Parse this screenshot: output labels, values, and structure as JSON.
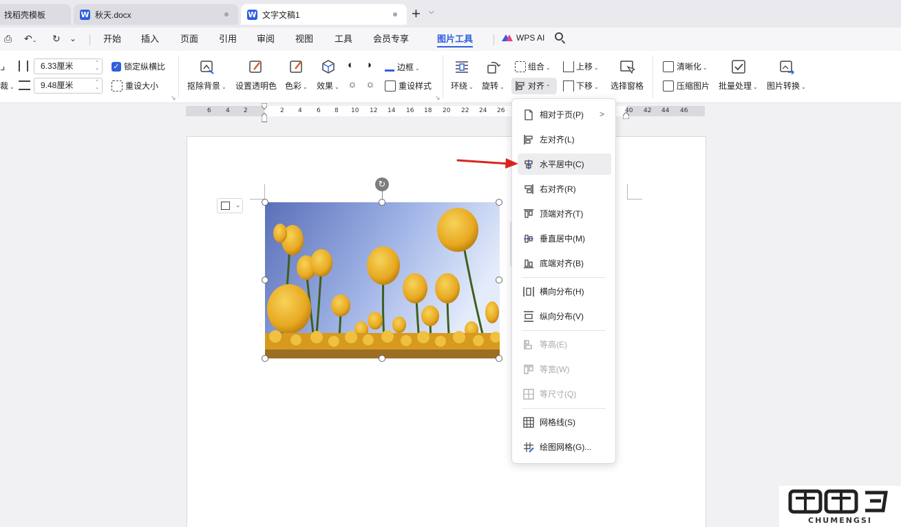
{
  "tabs": [
    {
      "label": "找稻壳模板",
      "active": false
    },
    {
      "label": "秋天.docx",
      "active": false,
      "icon": "word-icon"
    },
    {
      "label": "文字文稿1",
      "active": true,
      "icon": "word-icon"
    }
  ],
  "menu": {
    "items": [
      "开始",
      "插入",
      "页面",
      "引用",
      "审阅",
      "视图",
      "工具",
      "会员专享",
      "图片工具"
    ],
    "active": "图片工具",
    "ai_label": "WPS AI"
  },
  "ribbon": {
    "height_value": "6.33厘米",
    "width_value": "9.48厘米",
    "lock_ratio": "锁定纵横比",
    "reset_size": "重设大小",
    "remove_bg": "抠除背景",
    "set_transparent": "设置透明色",
    "color": "色彩",
    "effects": "效果",
    "border": "边框",
    "reset_style": "重设样式",
    "wrap": "环绕",
    "rotate": "旋转",
    "group": "组合",
    "align": "对齐",
    "bring_forward": "上移",
    "send_backward": "下移",
    "selection_pane": "选择窗格",
    "sharpen": "清晰化",
    "compress": "压缩图片",
    "batch": "批量处理",
    "convert": "图片转换"
  },
  "ruler": {
    "left_ticks": [
      "6",
      "4",
      "2"
    ],
    "right_ticks": [
      "2",
      "4",
      "6",
      "8",
      "10",
      "12",
      "14",
      "16",
      "18",
      "20",
      "22",
      "24",
      "26"
    ],
    "far_ticks": [
      "40",
      "42",
      "44",
      "46"
    ]
  },
  "align_menu": {
    "items": [
      {
        "label": "相对于页(P)",
        "icon": "relative-page-icon",
        "submenu": true
      },
      {
        "label": "左对齐(L)",
        "icon": "align-left-icon"
      },
      {
        "label": "水平居中(C)",
        "icon": "align-center-icon",
        "hover": true
      },
      {
        "label": "右对齐(R)",
        "icon": "align-right-icon"
      },
      {
        "label": "顶端对齐(T)",
        "icon": "align-top-icon"
      },
      {
        "label": "垂直居中(M)",
        "icon": "align-middle-icon"
      },
      {
        "label": "底端对齐(B)",
        "icon": "align-bottom-icon"
      },
      {
        "label": "横向分布(H)",
        "icon": "distribute-horizontal-icon"
      },
      {
        "label": "纵向分布(V)",
        "icon": "distribute-vertical-icon"
      },
      {
        "label": "等高(E)",
        "icon": "equal-height-icon",
        "disabled": true
      },
      {
        "label": "等宽(W)",
        "icon": "equal-width-icon",
        "disabled": true
      },
      {
        "label": "等尺寸(Q)",
        "icon": "equal-size-icon",
        "disabled": true
      },
      {
        "label": "网格线(S)",
        "icon": "gridlines-icon"
      },
      {
        "label": "绘图网格(G)...",
        "icon": "drawing-grid-icon"
      }
    ]
  },
  "watermark": {
    "text": "CHUMENGSI"
  },
  "colors": {
    "accent": "#2f5fdc",
    "arrow": "#d9251d"
  }
}
